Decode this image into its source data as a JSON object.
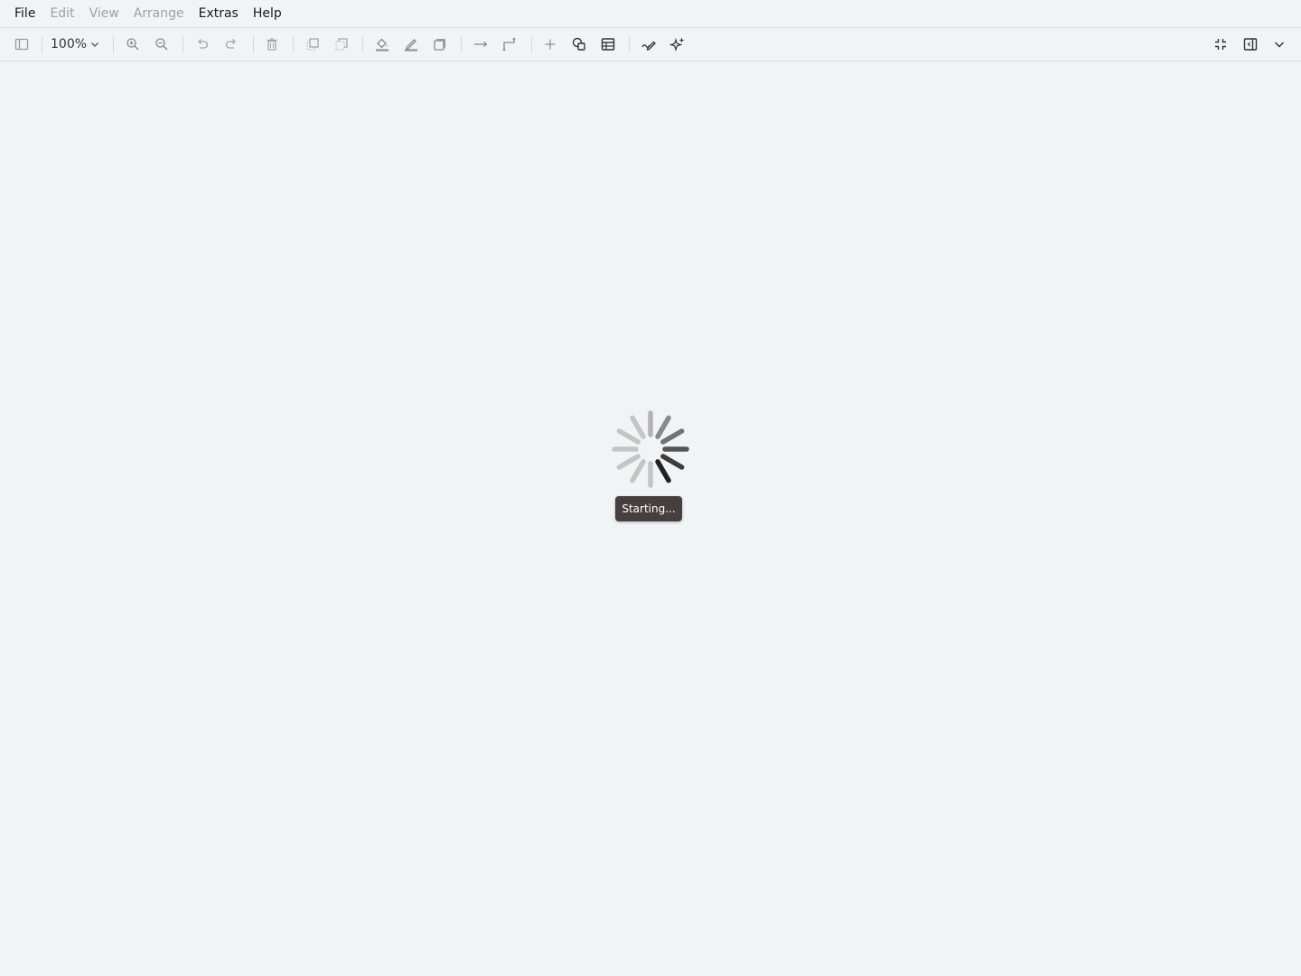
{
  "menubar": {
    "items": [
      {
        "label": "File",
        "enabled": true
      },
      {
        "label": "Edit",
        "enabled": false
      },
      {
        "label": "View",
        "enabled": false
      },
      {
        "label": "Arrange",
        "enabled": false
      },
      {
        "label": "Extras",
        "enabled": true
      },
      {
        "label": "Help",
        "enabled": true
      }
    ]
  },
  "toolbar": {
    "zoom_value": "100%",
    "icons": [
      "format-panel-icon",
      "zoom-in-icon",
      "zoom-out-icon",
      "undo-icon",
      "redo-icon",
      "delete-icon",
      "to-front-icon",
      "to-back-icon",
      "fill-color-icon",
      "line-color-icon",
      "shadow-icon",
      "connection-icon",
      "waypoints-icon",
      "insert-icon",
      "shapes-icon",
      "table-icon",
      "freehand-icon",
      "generate-icon",
      "fullscreen-icon",
      "toggle-panels-icon",
      "collapse-icon"
    ]
  },
  "status": {
    "text": "Starting..."
  },
  "colors": {
    "background": "#f1f3f5",
    "badge": "#473f3f"
  }
}
